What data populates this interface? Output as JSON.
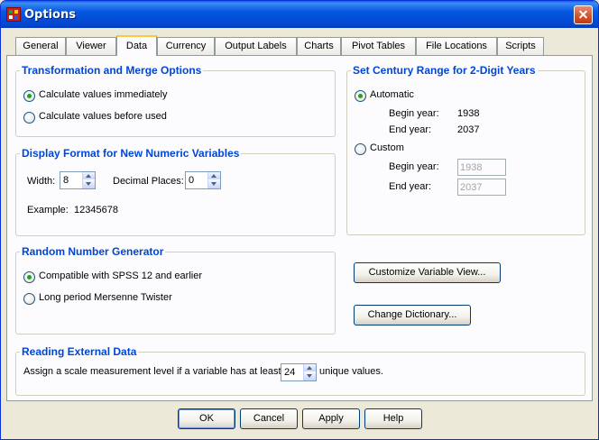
{
  "window": {
    "title": "Options"
  },
  "tabs": [
    {
      "label": "General"
    },
    {
      "label": "Viewer"
    },
    {
      "label": "Data",
      "active": true
    },
    {
      "label": "Currency"
    },
    {
      "label": "Output Labels"
    },
    {
      "label": "Charts"
    },
    {
      "label": "Pivot Tables"
    },
    {
      "label": "File Locations"
    },
    {
      "label": "Scripts"
    }
  ],
  "transformation": {
    "legend": "Transformation and Merge Options",
    "options": [
      {
        "label": "Calculate values immediately",
        "checked": true
      },
      {
        "label": "Calculate values before used",
        "checked": false
      }
    ]
  },
  "display_format": {
    "legend": "Display Format for New Numeric Variables",
    "width_label": "Width:",
    "width_value": "8",
    "decimal_label": "Decimal Places:",
    "decimal_value": "0",
    "example_label": "Example:",
    "example_value": "12345678"
  },
  "random": {
    "legend": "Random Number Generator",
    "options": [
      {
        "label": "Compatible with SPSS 12 and earlier",
        "checked": true
      },
      {
        "label": "Long period Mersenne Twister",
        "checked": false
      }
    ]
  },
  "century": {
    "legend": "Set Century Range for 2-Digit Years",
    "automatic_label": "Automatic",
    "automatic_checked": true,
    "auto_begin_label": "Begin year:",
    "auto_begin_value": "1938",
    "auto_end_label": "End year:",
    "auto_end_value": "2037",
    "custom_label": "Custom",
    "custom_checked": false,
    "custom_begin_label": "Begin year:",
    "custom_begin_value": "1938",
    "custom_end_label": "End year:",
    "custom_end_value": "2037"
  },
  "side_buttons": {
    "customize_view": "Customize Variable View...",
    "change_dictionary": "Change Dictionary..."
  },
  "external": {
    "legend": "Reading External Data",
    "prefix": "Assign a scale measurement level if a variable has at least",
    "value": "24",
    "suffix": "unique values."
  },
  "footer": {
    "ok": "OK",
    "cancel": "Cancel",
    "apply": "Apply",
    "help": "Help"
  }
}
